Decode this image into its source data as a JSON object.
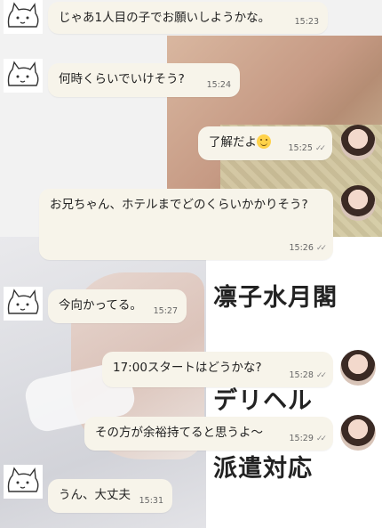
{
  "background_ad": {
    "lines": [
      "凛子水月閣",
      "デリヘル",
      "派遣対応"
    ]
  },
  "messages": [
    {
      "sender": "other",
      "text": "じゃあ1人目の子でお願いしようかな。",
      "time": "15:23"
    },
    {
      "sender": "other",
      "text": "何時くらいでいけそう?",
      "time": "15:24"
    },
    {
      "sender": "self",
      "text": "了解だよ",
      "emoji": "smiling-face",
      "time": "15:25",
      "read": true
    },
    {
      "sender": "self",
      "text": "お兄ちゃん、ホテルまでどのくらいかかりそう?",
      "time": "15:26",
      "read": true
    },
    {
      "sender": "other",
      "text": "今向かってる。",
      "time": "15:27"
    },
    {
      "sender": "self",
      "text": "17:00スタートはどうかな?",
      "time": "15:28",
      "read": true
    },
    {
      "sender": "self",
      "text": "その方が余裕持てると思うよ〜",
      "time": "15:29",
      "read": true
    },
    {
      "sender": "other",
      "text": "うん、大丈夫",
      "time": "15:31"
    }
  ],
  "ticks_glyph": "✓✓"
}
